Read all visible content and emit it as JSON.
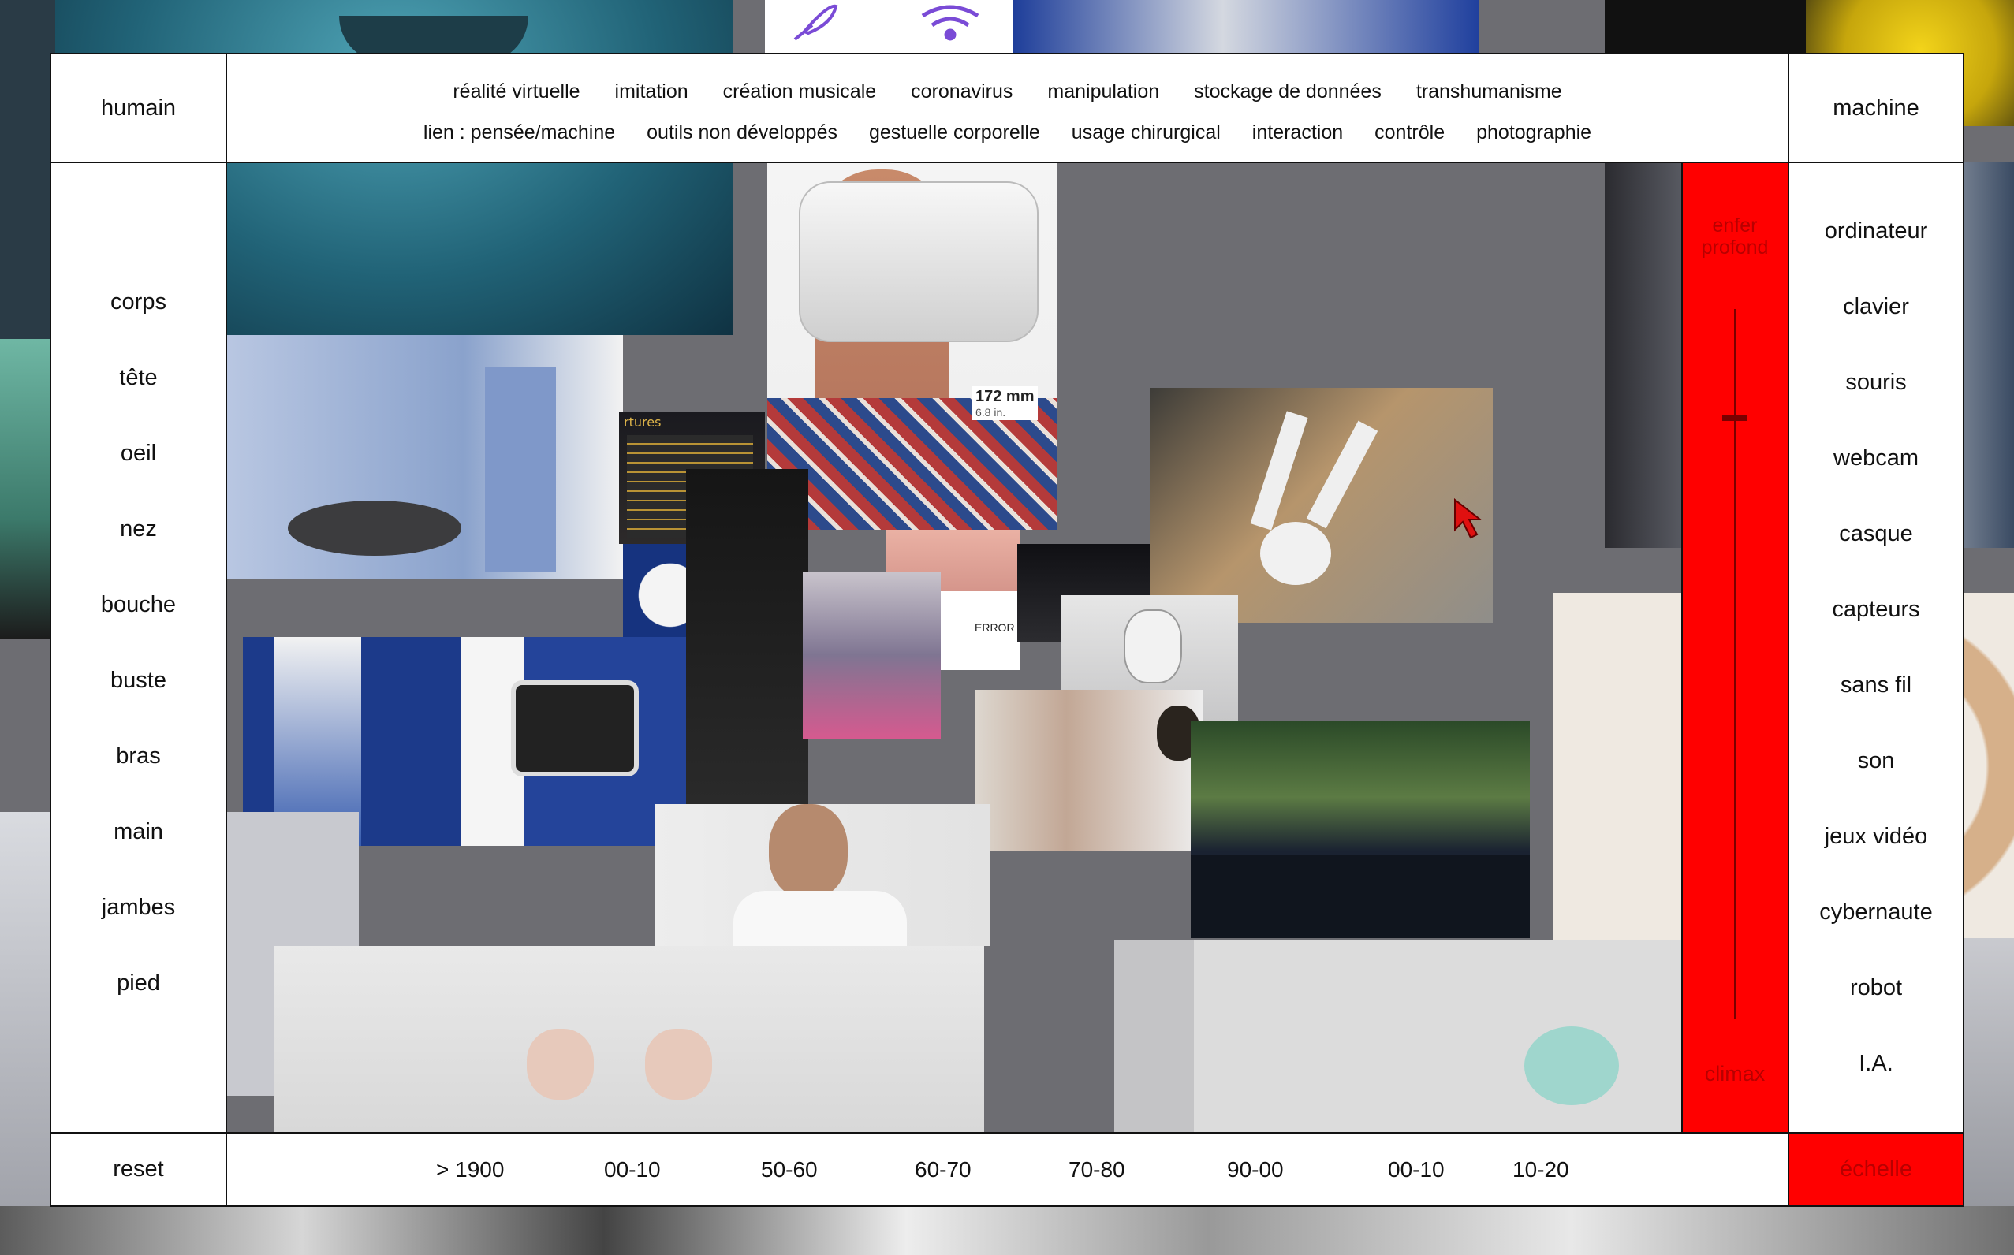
{
  "header": {
    "left_title": "humain",
    "right_title": "machine",
    "themes_row1": [
      "réalité virtuelle",
      "imitation",
      "création musicale",
      "coronavirus",
      "manipulation",
      "stockage de données",
      "transhumanisme"
    ],
    "themes_row2": [
      "lien : pensée/machine",
      "outils non développés",
      "gestuelle corporelle",
      "usage chirurgical",
      "interaction",
      "contrôle",
      "photographie"
    ]
  },
  "left_nav": [
    "corps",
    "tête",
    "oeil",
    "nez",
    "bouche",
    "buste",
    "bras",
    "main",
    "jambes",
    "pied"
  ],
  "right_nav": [
    "ordinateur",
    "clavier",
    "souris",
    "webcam",
    "casque",
    "capteurs",
    "sans fil",
    "son",
    "jeux vidéo",
    "cybernaute",
    "robot",
    "I.A."
  ],
  "scale": {
    "top_label": "enfer profond",
    "bottom_label": "climax",
    "button": "échelle",
    "level": 0.15,
    "accent": "#ff0000"
  },
  "footer": {
    "reset": "reset",
    "decades": [
      "> 1900",
      "00-10",
      "50-60",
      "60-70",
      "70-80",
      "90-00",
      "00-10",
      "10-20"
    ]
  },
  "photo_labels": {
    "vr_measure": "172 mm",
    "vr_measure_sub": "6.8 in.",
    "error": "ERROR",
    "screen_text": "rtures"
  },
  "icons": [
    "feather-icon",
    "wifi-icon",
    "cursor-arrow-icon"
  ]
}
